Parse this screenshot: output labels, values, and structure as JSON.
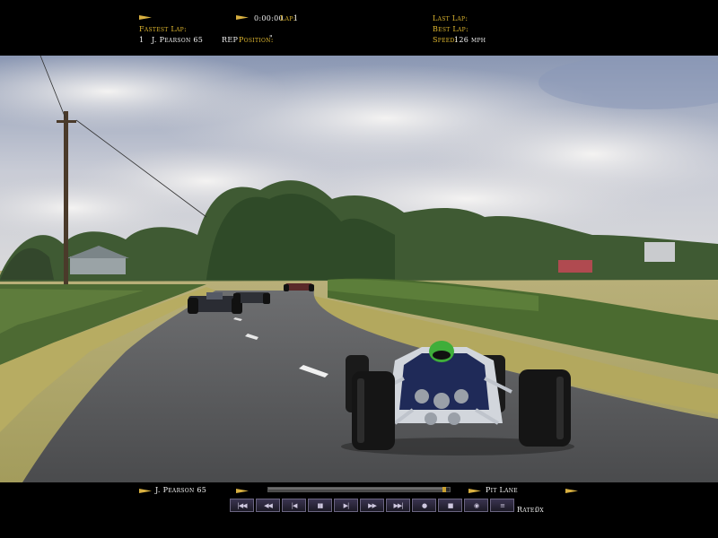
{
  "top_hud": {
    "timer": "0:00:00",
    "lap_label": "Lap:",
    "lap_value": "1",
    "fastest_lap_label": "Fastest Lap:",
    "fastest_lap_position": "1",
    "fastest_lap_driver": "J. Pearson 65",
    "rep_label": "REP",
    "position_label": "Position:",
    "position_value": "\"",
    "last_lap_label": "Last Lap:",
    "best_lap_label": "Best Lap:",
    "speed_label": "Speed:",
    "speed_value": "126 mph"
  },
  "bottom_hud": {
    "driver": "J. Pearson 65",
    "camera": "Pit Lane",
    "rate_label": "Rate:",
    "rate_value": "0x",
    "progress_fraction": 0.98,
    "controls": [
      {
        "name": "skip-to-start-button",
        "glyph": "|◀◀"
      },
      {
        "name": "fast-rewind-button",
        "glyph": "◀◀"
      },
      {
        "name": "step-back-button",
        "glyph": "|◀"
      },
      {
        "name": "pause-button",
        "glyph": "▮▮"
      },
      {
        "name": "step-forward-button",
        "glyph": "▶|"
      },
      {
        "name": "play-button",
        "glyph": "▶▶"
      },
      {
        "name": "skip-to-end-button",
        "glyph": "▶▶|"
      },
      {
        "name": "record-button",
        "glyph": "●"
      },
      {
        "name": "stop-button",
        "glyph": "■"
      },
      {
        "name": "camera-button",
        "glyph": "◉"
      },
      {
        "name": "options-button",
        "glyph": "≡"
      }
    ]
  },
  "colors": {
    "label_gold": "#e0b830",
    "value_white": "#f2f2f2",
    "hud_black": "#000000"
  }
}
